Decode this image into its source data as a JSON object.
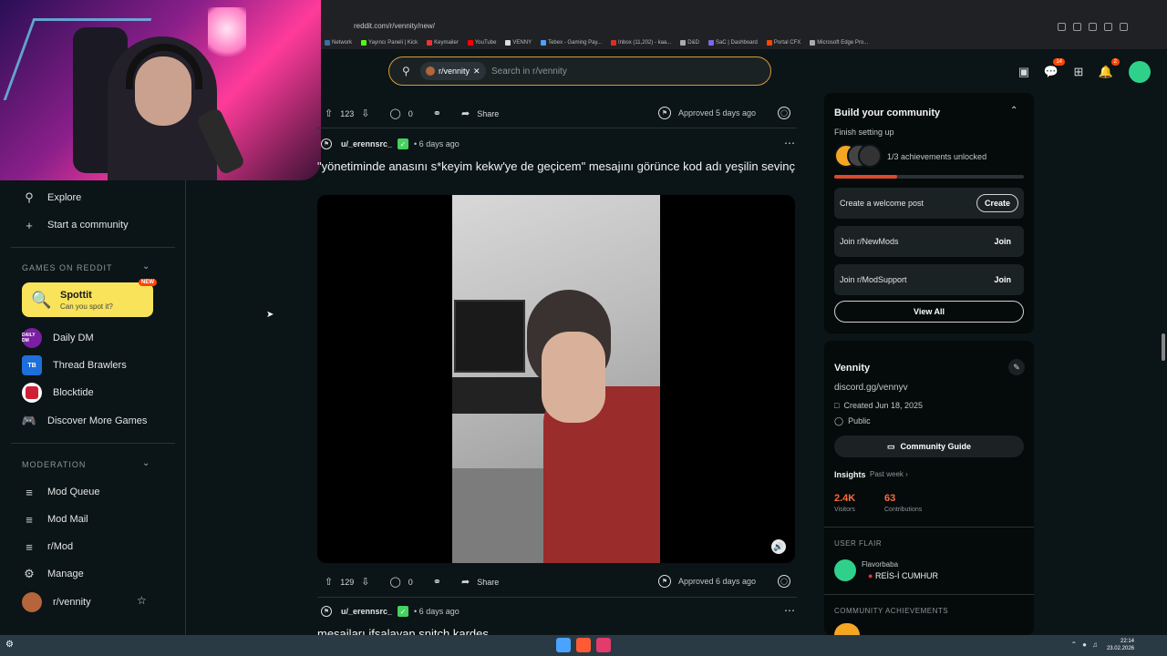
{
  "browser": {
    "url": "reddit.com/r/vennity/new/",
    "bookmarks": [
      {
        "label": "Network",
        "color": "#3a6ea5"
      },
      {
        "label": "Yayıncı Paneli | Kick",
        "color": "#53fc18"
      },
      {
        "label": "Keymailer",
        "color": "#e33"
      },
      {
        "label": "YouTube",
        "color": "#ff0000"
      },
      {
        "label": "VENNY",
        "color": "#ddd"
      },
      {
        "label": "Tebex - Gaming Pay...",
        "color": "#4aa3ff"
      },
      {
        "label": "Inbox (11,202) - kaa...",
        "color": "#d93025"
      },
      {
        "label": "D&D",
        "color": "#aaa"
      },
      {
        "label": "SaC | Dashboard",
        "color": "#7b68ee"
      },
      {
        "label": "Portal CFX",
        "color": "#f40"
      },
      {
        "label": "Microsoft Edge Pro...",
        "color": "#aaa"
      }
    ]
  },
  "search": {
    "chip_label": "r/vennity",
    "placeholder": "Search in r/vennity"
  },
  "header": {
    "chat_badge": "14",
    "notif_badge": "2"
  },
  "leftnav": {
    "explore": "Explore",
    "start_community": "Start a community",
    "games_section": "GAMES ON REDDIT",
    "spottit_title": "Spottit",
    "spottit_sub": "Can you spot it?",
    "spottit_badge": "NEW",
    "games": [
      {
        "label": "Daily DM",
        "icon_text": "DAILY DM",
        "color": "#7a1fa2"
      },
      {
        "label": "Thread Brawlers",
        "icon_text": "TB",
        "color": "#1e6fd9"
      },
      {
        "label": "Blocktide",
        "icon_text": "",
        "color": "#cc2233"
      }
    ],
    "discover_games": "Discover More Games",
    "moderation_section": "MODERATION",
    "mod_items": [
      "Mod Queue",
      "Mod Mail",
      "r/Mod",
      "Manage"
    ],
    "community": "r/vennity"
  },
  "feed": {
    "post1_actions": {
      "votes": "123",
      "comments": "0",
      "share": "Share",
      "approved": "Approved 5 days ago"
    },
    "post2": {
      "author": "u/_erennsrc_",
      "age": "• 6 days ago",
      "title": "\"yönetiminde anasını s*keyim kekw'ye de geçicem\" mesajını görünce kod adı yeşilin sevinç",
      "votes": "129",
      "comments": "0",
      "share": "Share",
      "approved": "Approved 6 days ago"
    },
    "post3": {
      "author": "u/_erennsrc_",
      "age": "• 6 days ago",
      "title_partial": "mesajları ifşalayan snitch kardeş"
    }
  },
  "right": {
    "build_title": "Build your community",
    "finish_setup": "Finish setting up",
    "achievements": "1/3 achievements unlocked",
    "progress": 0.33,
    "tasks": [
      {
        "label": "Create a welcome post",
        "button": "Create"
      },
      {
        "label": "Join r/NewMods",
        "button": "Join"
      },
      {
        "label": "Join r/ModSupport",
        "button": "Join"
      }
    ],
    "view_all": "View All",
    "community_name": "Vennity",
    "community_link": "discord.gg/vennyv",
    "created": "Created Jun 18, 2025",
    "visibility": "Public",
    "guide": "Community Guide",
    "insights": "Insights",
    "insights_period": "Past week ›",
    "visitors_num": "2.4K",
    "visitors_lbl": "Visitors",
    "contrib_num": "63",
    "contrib_lbl": "Contributions",
    "user_flair_head": "USER FLAIR",
    "flair_user": "Flavorbaba",
    "flair_text": "REİS-İ CUMHUR",
    "achievements_head": "COMMUNITY ACHIEVEMENTS"
  },
  "taskbar": {
    "time": "22:14",
    "date": "23.02.2026"
  }
}
